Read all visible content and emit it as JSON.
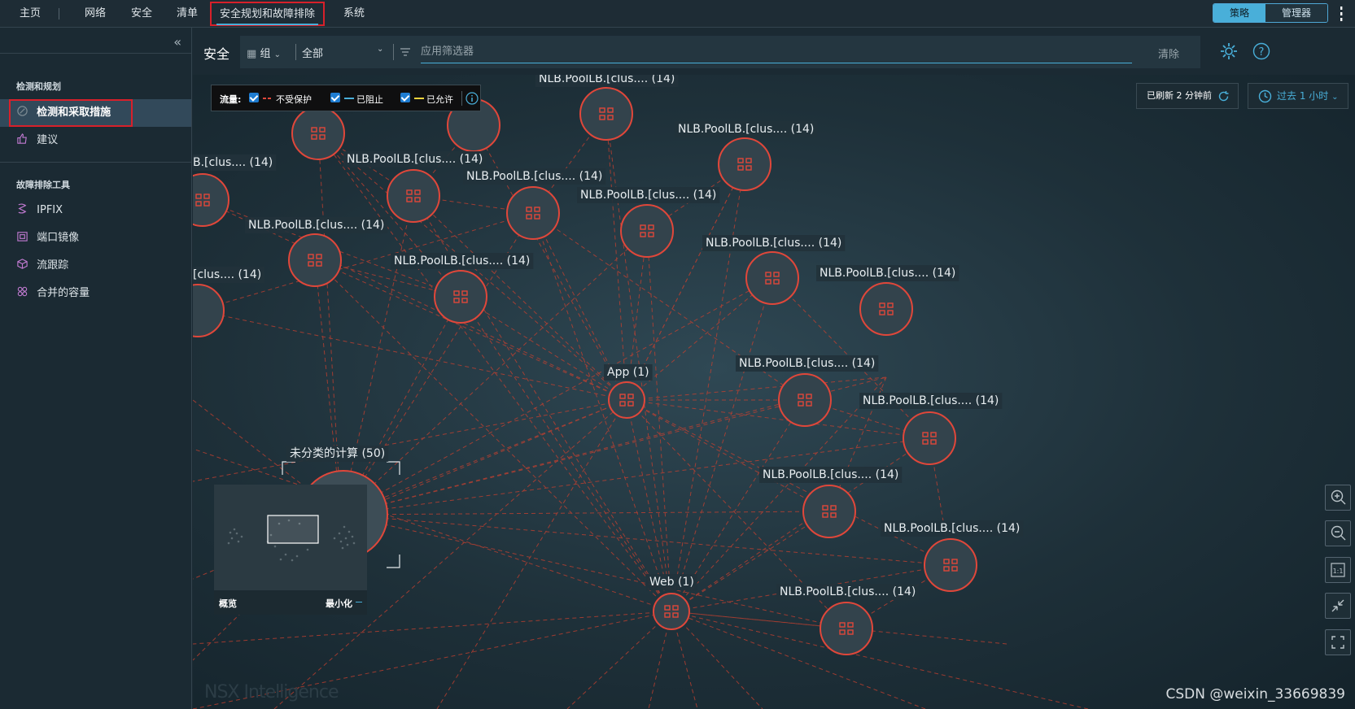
{
  "topnav": {
    "home": "主页",
    "network": "网络",
    "security": "安全",
    "inventory": "清单",
    "plan_troubleshoot": "安全规划和故障排除",
    "system": "系统",
    "policy": "策略",
    "manager": "管理器"
  },
  "sidebar": {
    "section1": "检测和规划",
    "item_discover": "检测和采取措施",
    "item_recommend": "建议",
    "section2": "故障排除工具",
    "tools": [
      "IPFIX",
      "端口镜像",
      "流跟踪",
      "合并的容量"
    ]
  },
  "filter": {
    "title": "安全",
    "group": "组",
    "all": "全部",
    "placeholder": "应用筛选器",
    "clear": "清除"
  },
  "legend": {
    "flows": "流量:",
    "unprotected": "不受保护",
    "blocked": "已阻止",
    "allowed": "已允许",
    "colors": {
      "unprotected": "#e0473a",
      "blocked": "#49afd9",
      "allowed": "#f2d33c"
    }
  },
  "refresh_text": "已刷新 2 分钟前",
  "time_range": "过去 1 小时",
  "graph": {
    "node_label": "NLB.PoolLB.[clus.... (14)",
    "app": "App (1)",
    "web": "Web (1)",
    "uncategorized": "未分类的计算 (50)",
    "partial_left1": "B.[clus.... (14)",
    "partial_left2": "[clus.... (14)",
    "partial_top": "NLB.PoolLB.[clus.... (14)"
  },
  "overview": {
    "label": "概览",
    "minimize": "最小化"
  },
  "watermark": "NSX Intelligence",
  "csdn": "CSDN @weixin_33669839"
}
